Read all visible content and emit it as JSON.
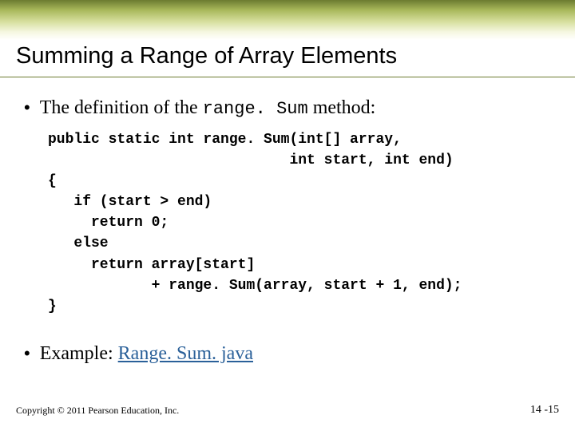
{
  "slide": {
    "title": "Summing a Range of Array Elements",
    "bullets": [
      {
        "prefix": "The definition of the ",
        "code": "range. Sum",
        "suffix": " method:"
      },
      {
        "prefix": "Example: ",
        "link": "Range. Sum. java"
      }
    ],
    "code": "public static int range. Sum(int[] array,\n                            int start, int end)\n{\n   if (start > end)\n     return 0;\n   else\n     return array[start]\n            + range. Sum(array, start + 1, end);\n}",
    "footer": {
      "copyright": "Copyright © 2011 Pearson Education, Inc.",
      "page": "14 -15"
    }
  }
}
